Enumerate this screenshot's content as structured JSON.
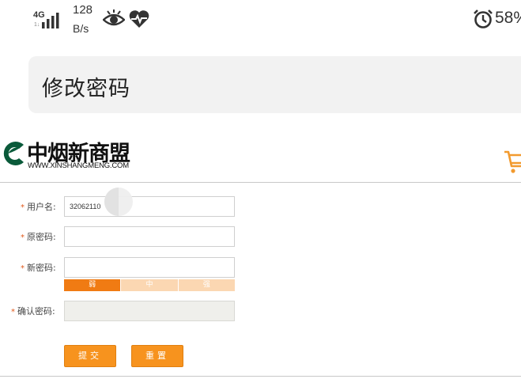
{
  "status_bar": {
    "network_type": "4G",
    "network_sub": "1↓",
    "speed_value": "128",
    "speed_unit": "B/s",
    "battery": "58%",
    "icons": [
      "signal-icon",
      "eye-icon",
      "heartbeat-icon",
      "alarm-icon"
    ]
  },
  "title_bar": {
    "title": "修改密码"
  },
  "header": {
    "logo_name": "中烟新商盟",
    "logo_url": "WWW.XINSHANGMENG.COM",
    "cart_icon": "cart-icon"
  },
  "form": {
    "required_mark": "*",
    "username_label": "用户名:",
    "username_value": "32062110",
    "old_password_label": "原密码:",
    "old_password_value": "",
    "new_password_label": "新密码:",
    "new_password_value": "",
    "strength": {
      "weak": "弱",
      "medium": "中",
      "strong": "强",
      "level": "weak"
    },
    "confirm_label": "确认密码:",
    "confirm_value": "",
    "submit_label": "提交",
    "reset_label": "重置"
  },
  "colors": {
    "accent": "#f7931e",
    "strength_active": "#f07b13",
    "strength_inactive": "#fbd7b2",
    "required": "#e05a1c",
    "title_bg": "#f2f2f2"
  }
}
